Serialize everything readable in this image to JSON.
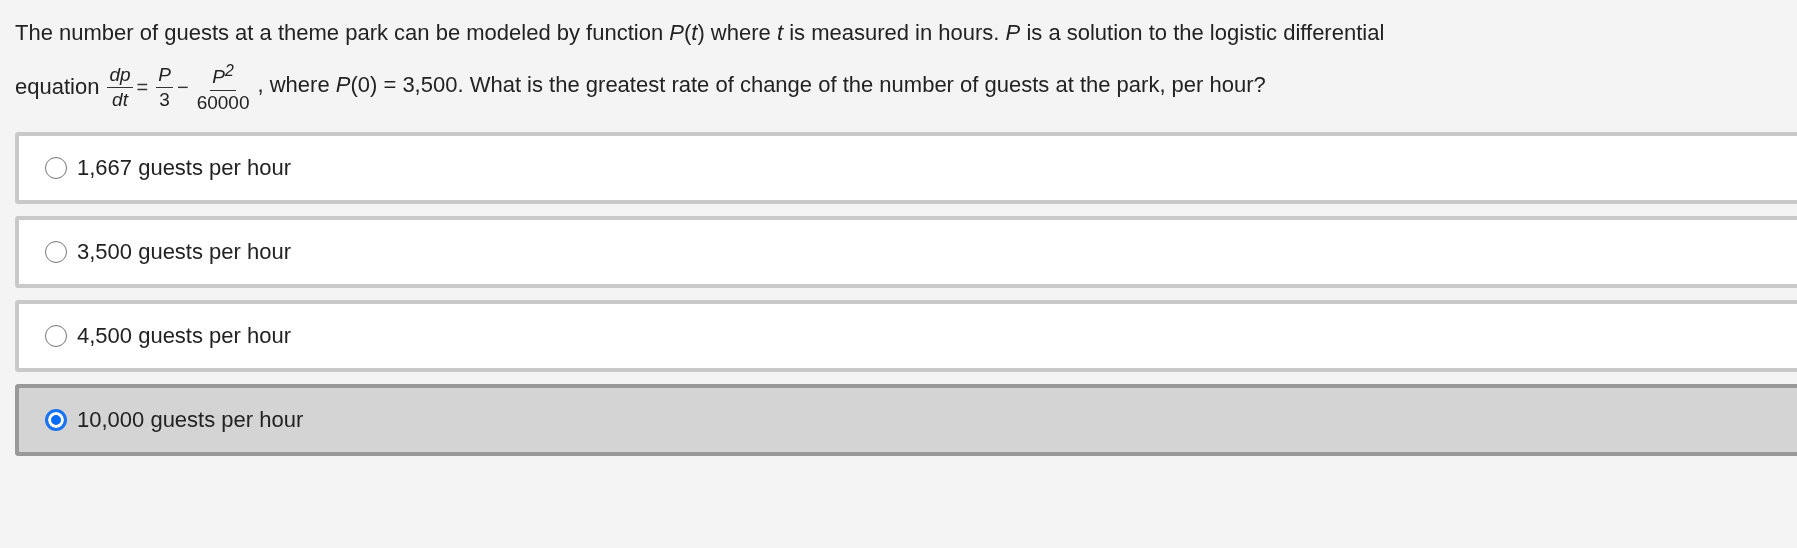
{
  "question": {
    "line_1": "The number of guests at a theme park can be modeled by function *P*(*t*) where *t* is measured in hours. *P* is a solution to the logistic differential",
    "lead": "equation",
    "equation": {
      "lhs": {
        "numerator": "dp",
        "denominator": "dt"
      },
      "equals": "=",
      "term_1": {
        "numerator": "P",
        "denominator": "3"
      },
      "minus": "−",
      "term_2": {
        "numerator": "P$^{2}$",
        "denominator": "60000"
      }
    },
    "trail": ", where *P*(0) = 3,500. What is the greatest rate of change of the number of guests at the park, per hour?"
  },
  "options": [
    {
      "label": "1,667 guests per hour",
      "selected": false
    },
    {
      "label": "3,500 guests per hour",
      "selected": false
    },
    {
      "label": "4,500 guests per hour",
      "selected": false
    },
    {
      "label": "10,000 guests per hour",
      "selected": true
    }
  ]
}
